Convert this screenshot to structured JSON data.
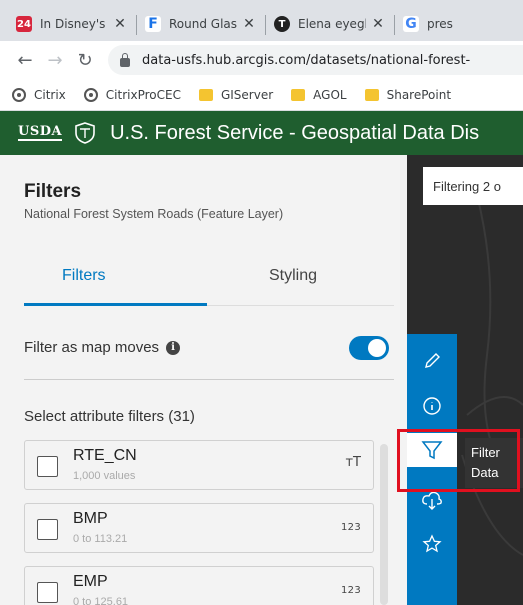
{
  "browser": {
    "tabs": [
      {
        "title": "In Disney's ",
        "favicon_label": "24",
        "favicon_color": "#d7263d"
      },
      {
        "title": "Round Glass",
        "favicon_label": "F",
        "favicon_color": "#1a73e8"
      },
      {
        "title": "Elena eyegla",
        "favicon_label": "T",
        "favicon_color": "#222222"
      },
      {
        "title": "pres",
        "favicon_label": "G",
        "favicon_color": "#4285f4"
      }
    ],
    "url": "data-usfs.hub.arcgis.com/datasets/national-forest-",
    "bookmarks": [
      {
        "label": "Citrix",
        "icon": "citrix-icon"
      },
      {
        "label": "CitrixProCEC",
        "icon": "citrix-icon"
      },
      {
        "label": "GIServer",
        "icon": "folder-icon"
      },
      {
        "label": "AGOL",
        "icon": "folder-icon"
      },
      {
        "label": "SharePoint",
        "icon": "folder-icon"
      }
    ]
  },
  "header": {
    "usda": "USDA",
    "title": "U.S. Forest Service - Geospatial Data Dis",
    "bg_color": "#1f5e2f"
  },
  "panel": {
    "title": "Filters",
    "subtitle": "National Forest System Roads (Feature Layer)",
    "tabs": {
      "filters": "Filters",
      "styling": "Styling"
    },
    "filter_as_map_moves": "Filter as map moves",
    "toggle_on": true,
    "select_attr": "Select attribute filters (31)",
    "attributes": [
      {
        "name": "RTE_CN",
        "sub": "1,000 values",
        "type": "ᴛT"
      },
      {
        "name": "BMP",
        "sub": "0 to 113.21",
        "type": "123"
      },
      {
        "name": "EMP",
        "sub": "0 to 125.61",
        "type": "123"
      }
    ]
  },
  "map": {
    "filtering_text": "Filtering 2 o",
    "tooltip_line1": "Filter",
    "tooltip_line2": "Data",
    "accent": "#0079c1"
  }
}
